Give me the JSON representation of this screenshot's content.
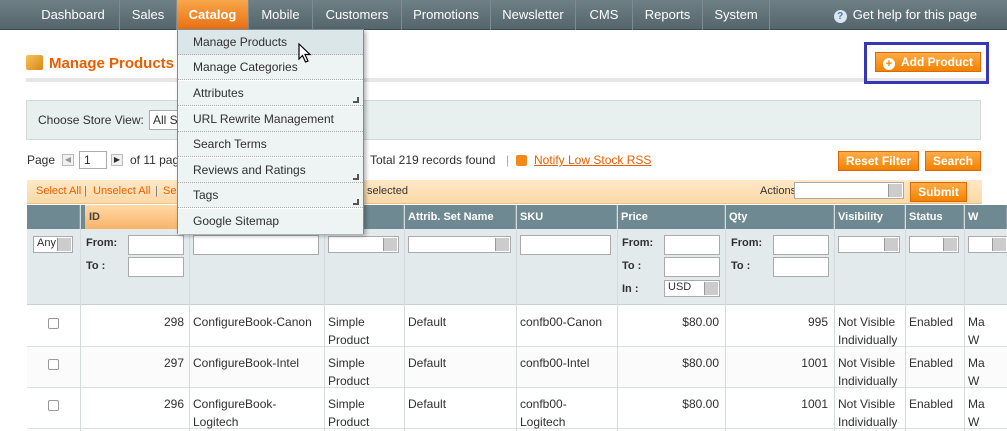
{
  "nav": {
    "items": [
      "Dashboard",
      "Sales",
      "Catalog",
      "Mobile",
      "Customers",
      "Promotions",
      "Newsletter",
      "CMS",
      "Reports",
      "System"
    ],
    "active": "Catalog",
    "help": "Get help for this page"
  },
  "catalog_menu": [
    "Manage Products",
    "Manage Categories",
    "Attributes",
    "URL Rewrite Management",
    "Search Terms",
    "Reviews and Ratings",
    "Tags",
    "Google Sitemap"
  ],
  "page": {
    "title": "Manage Products",
    "add_button": "Add Product"
  },
  "store_switcher": {
    "label": "Choose Store View:",
    "value": "All S"
  },
  "pager": {
    "page_label": "Page",
    "page_value": "1",
    "of_pages": "of 11 pag",
    "total": "Total 219 records found",
    "rss_link": "Notify Low Stock RSS",
    "reset_filter": "Reset Filter",
    "search": "Search"
  },
  "massaction": {
    "select_all": "Select All",
    "unselect_all": "Unselect All",
    "sel_partial": "Se",
    "selected": "selected",
    "actions_label": "Actions",
    "submit": "Submit"
  },
  "grid": {
    "columns": [
      "",
      "ID",
      "",
      "",
      "Attrib. Set Name",
      "SKU",
      "Price",
      "Qty",
      "Visibility",
      "Status",
      "W"
    ],
    "filters": {
      "any": "Any",
      "from": "From:",
      "to": "To :",
      "in": "In :",
      "currency": "USD"
    },
    "rows": [
      {
        "id": "298",
        "name": "ConfigureBook-Canon",
        "type": [
          "Simple",
          "Product"
        ],
        "set": "Default",
        "sku": [
          "confb00-Canon"
        ],
        "price": "$80.00",
        "qty": "995",
        "visibility": [
          "Not Visible",
          "Individually"
        ],
        "status": "Enabled",
        "w": [
          "Ma",
          "W"
        ]
      },
      {
        "id": "297",
        "name": "ConfigureBook-Intel",
        "type": [
          "Simple",
          "Product"
        ],
        "set": "Default",
        "sku": [
          "confb00-Intel"
        ],
        "price": "$80.00",
        "qty": "1001",
        "visibility": [
          "Not Visible",
          "Individually"
        ],
        "status": "Enabled",
        "w": [
          "Ma",
          "W"
        ]
      },
      {
        "id": "296",
        "name": "ConfigureBook-Logitech",
        "type": [
          "Simple",
          "Product"
        ],
        "set": "Default",
        "sku": [
          "confb00-",
          "Logitech"
        ],
        "price": "$80.00",
        "qty": "1001",
        "visibility": [
          "Not Visible",
          "Individually"
        ],
        "status": "Enabled",
        "w": [
          "Ma",
          "W"
        ]
      }
    ]
  },
  "colors": {
    "accent": "#eb5e00",
    "button": "#f18200",
    "nav": "#5f7077",
    "highlight_box": "#3537b5"
  }
}
